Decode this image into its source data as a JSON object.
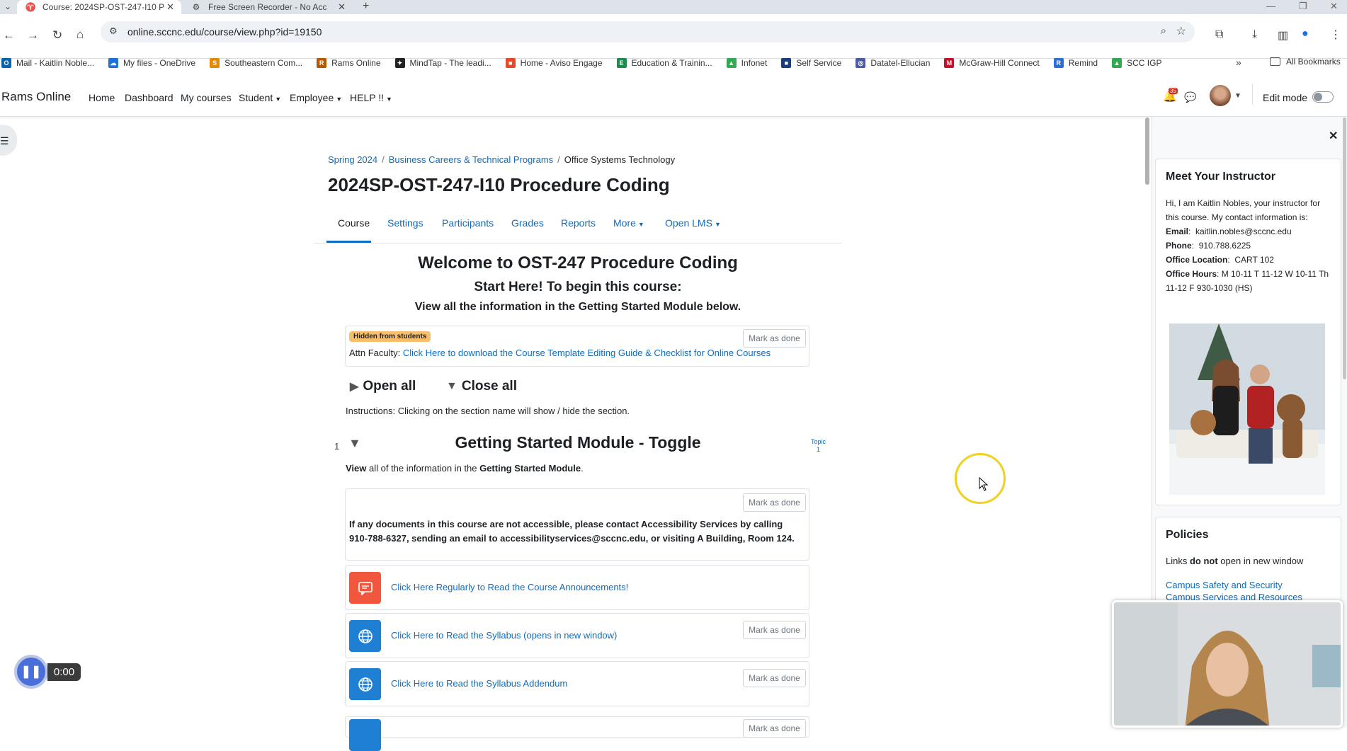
{
  "browser": {
    "tabs": [
      {
        "title": "Course: 2024SP-OST-247-I10 P",
        "active": true
      },
      {
        "title": "Free Screen Recorder - No Acc",
        "active": false
      }
    ],
    "url": "online.sccnc.edu/course/view.php?id=19150",
    "bookmarks": [
      {
        "label": "Mail - Kaitlin Noble...",
        "icon_color": "#0a64ad",
        "icon": "O"
      },
      {
        "label": "My files - OneDrive",
        "icon_color": "#1e73d8",
        "icon": "☁"
      },
      {
        "label": "Southeastern Com...",
        "icon_color": "#e08a00",
        "icon": "S"
      },
      {
        "label": "Rams Online",
        "icon_color": "#b35a00",
        "icon": "R"
      },
      {
        "label": "MindTap - The leadi...",
        "icon_color": "#222",
        "icon": "✦"
      },
      {
        "label": "Home - Aviso Engage",
        "icon_color": "#e34b2a",
        "icon": "■"
      },
      {
        "label": "Education & Trainin...",
        "icon_color": "#1f8a4c",
        "icon": "E"
      },
      {
        "label": "Infonet",
        "icon_color": "#34a853",
        "icon": "▲"
      },
      {
        "label": "Self Service",
        "icon_color": "#1a3d7c",
        "icon": "■"
      },
      {
        "label": "Datatel-Ellucian",
        "icon_color": "#4b5aa8",
        "icon": "◎"
      },
      {
        "label": "McGraw-Hill Connect",
        "icon_color": "#c8102e",
        "icon": "M"
      },
      {
        "label": "Remind",
        "icon_color": "#2b6fd6",
        "icon": "R"
      },
      {
        "label": "SCC IGP",
        "icon_color": "#34a853",
        "icon": "▲"
      }
    ],
    "all_bookmarks_label": "All Bookmarks"
  },
  "sitenav": {
    "brand": "Rams Online",
    "items": [
      "Home",
      "Dashboard",
      "My courses",
      "Student",
      "Employee",
      "HELP !!"
    ],
    "notification_count": "35",
    "edit_mode_label": "Edit mode"
  },
  "breadcrumb": [
    "Spring 2024",
    "Business Careers & Technical Programs",
    "Office Systems Technology"
  ],
  "course_title": "2024SP-OST-247-I10 Procedure Coding",
  "secondary_nav": [
    "Course",
    "Settings",
    "Participants",
    "Grades",
    "Reports",
    "More",
    "Open LMS"
  ],
  "welcome": {
    "heading": "Welcome to OST-247 Procedure Coding",
    "start_here": "Start Here!  To begin this course:",
    "view_info": "View all the information in the Getting Started Module below."
  },
  "faculty_card": {
    "badge": "Hidden from students",
    "attn_prefix": "Attn Faculty: ",
    "attn_link": "Click Here to download the Course Template Editing Guide & Checklist for Online Courses",
    "mark_label": "Mark as done"
  },
  "toggles": {
    "open_all": "Open all",
    "close_all": "Close all"
  },
  "instructions": "Instructions: Clicking on the section name will show / hide the section.",
  "section": {
    "number": "1",
    "title": "Getting Started Module - Toggle",
    "topic_label_1": "Topic",
    "topic_label_2": "1",
    "desc_bold1": "View",
    "desc_mid": " all of the information in the ",
    "desc_bold2": "Getting Started Module",
    "desc_end": "."
  },
  "accessibility_text": "If any documents in this course are not accessible, please contact Accessibility Services by calling 910-788-6327, sending an email to accessibilityservices@sccnc.edu, or visiting A Building, Room 124.",
  "activities": [
    {
      "label": "Click Here Regularly to Read the Course Announcements!",
      "icon": "forum",
      "color": "#f0573c"
    },
    {
      "label": "Click Here to Read the Syllabus (opens in new window)",
      "icon": "url",
      "color": "#1f7fd3"
    },
    {
      "label": "Click Here to Read the Syllabus Addendum",
      "icon": "url",
      "color": "#1f7fd3"
    }
  ],
  "mark_as_done": "Mark as done",
  "instructor_block": {
    "title": "Meet Your Instructor",
    "intro": "Hi, I am Kaitlin Nobles, your instructor for this course.  My contact information is:",
    "email_label": "Email",
    "email": "kaitlin.nobles@sccnc.edu",
    "phone_label": "Phone",
    "phone": "910.788.6225",
    "office_label": "Office Location",
    "office": "CART 102",
    "hours_label": "Office Hours",
    "hours": "M 10-11 T 11-12 W 10-11 Th 11-12 F 930-1030 (HS)"
  },
  "policies_block": {
    "title": "Policies",
    "text_pre": "Links ",
    "text_bold": "do not",
    "text_post": " open in new window",
    "links": [
      "Campus Safety and Security",
      "Campus Services and Resources"
    ]
  },
  "recorder": {
    "time": "0:00"
  }
}
